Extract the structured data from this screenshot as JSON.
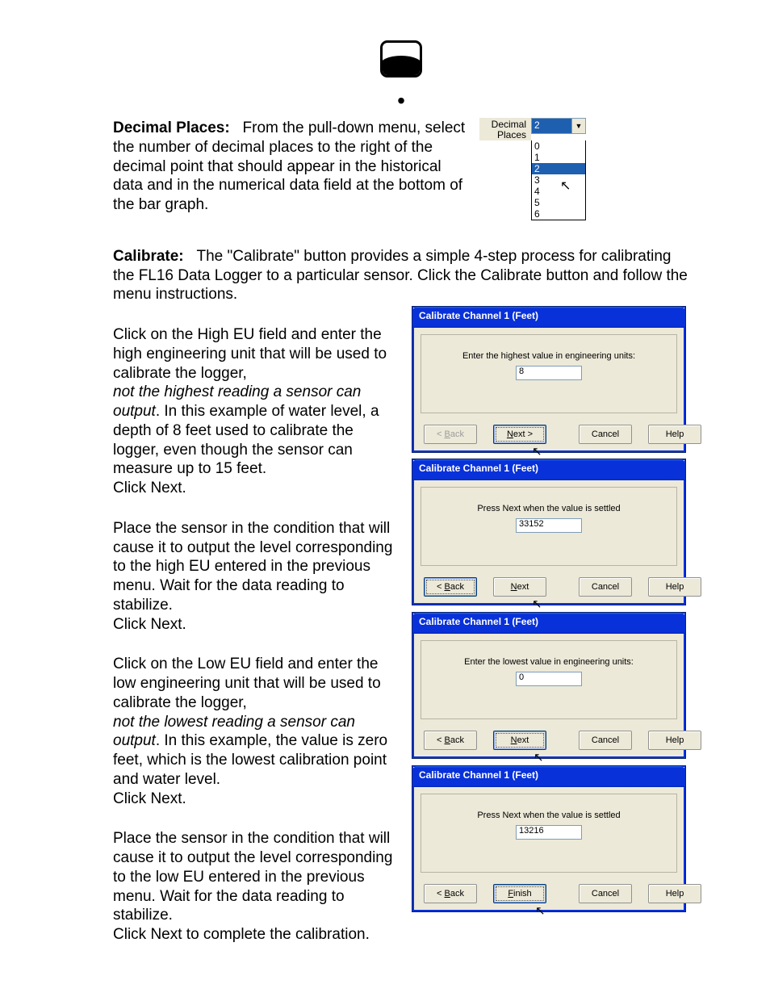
{
  "decimal": {
    "heading": "Decimal Places:",
    "body": "From the pull-down menu, select the number of decimal places to the right of the decimal point that should appear in the historical data and in the numerical data field at the bottom of the bar graph.",
    "label_line1": "Decimal",
    "label_line2": "Places",
    "selected": "2",
    "options": [
      "0",
      "1",
      "2",
      "3",
      "4",
      "5",
      "6"
    ],
    "highlight": "2"
  },
  "calibrate": {
    "heading": "Calibrate:",
    "intro": "The \"Calibrate\" button provides a simple 4-step process for calibrating the FL16 Data Logger to a particular sensor.  Click the Calibrate button and follow the menu instructions.",
    "step1": {
      "p1": "Click on the High EU field and enter the high engineering unit that will be used to calibrate the logger,",
      "italic": "not the highest reading a sensor can output",
      "p2": ". In this example of water level, a depth of 8 feet used to calibrate the logger, even though the sensor can measure up to 15 feet.",
      "p3": "Click Next.",
      "dialog_title": "Calibrate Channel 1 (Feet)",
      "prompt": "Enter the highest value in engineering units:",
      "value": "8",
      "btn_back": "< Back",
      "btn_next": "Next >",
      "btn_cancel": "Cancel",
      "btn_help": "Help"
    },
    "step2": {
      "p1": "Place the sensor in the condition that will cause it to output the level corresponding to the high EU entered in the previous menu. Wait for the data reading to stabilize.",
      "p2": "Click Next.",
      "dialog_title": "Calibrate Channel 1 (Feet)",
      "prompt": "Press Next when the value is settled",
      "value": "33152",
      "btn_back": "< Back",
      "btn_next": "Next",
      "btn_cancel": "Cancel",
      "btn_help": "Help"
    },
    "step3": {
      "p1": "Click on the Low EU field and enter the low engineering unit that will be used to calibrate the logger,",
      "italic": "not the lowest reading a sensor can output",
      "p2": ". In this example, the value is zero feet, which is the lowest calibration point and water level.",
      "p3": "Click Next.",
      "dialog_title": "Calibrate Channel 1 (Feet)",
      "prompt": "Enter the lowest value in engineering units:",
      "value": "0",
      "btn_back": "< Back",
      "btn_next": "Next",
      "btn_cancel": "Cancel",
      "btn_help": "Help"
    },
    "step4": {
      "p1": "Place the sensor in the condition that will cause it to output the level corresponding to the low EU entered in the previous menu. Wait for the data reading to stabilize.",
      "p2": "Click Next to complete the calibration.",
      "dialog_title": "Calibrate Channel 1 (Feet)",
      "prompt": "Press Next when the value is settled",
      "value": "13216",
      "btn_back": "< Back",
      "btn_next": "Finish",
      "btn_cancel": "Cancel",
      "btn_help": "Help"
    }
  }
}
